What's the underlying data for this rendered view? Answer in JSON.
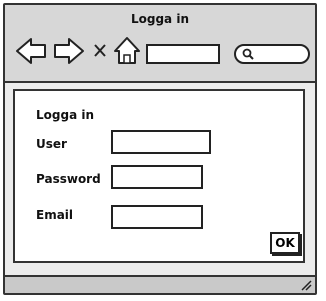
{
  "window": {
    "title": "Logga in"
  },
  "toolbar": {
    "icons": [
      "back-arrow-icon",
      "forward-arrow-icon",
      "close-x-icon",
      "home-icon",
      "address-bar",
      "search-icon"
    ],
    "address_value": "",
    "search_value": ""
  },
  "form": {
    "heading": "Logga in",
    "user_label": "User",
    "user_value": "",
    "password_label": "Password",
    "password_value": "",
    "email_label": "Email",
    "email_value": "",
    "ok_label": "OK"
  },
  "statusbar": {
    "icon": "resize-grip-icon"
  },
  "colors": {
    "toolbar_bg": "#d7d7d7",
    "window_bg": "#ececec",
    "line": "#333333"
  }
}
